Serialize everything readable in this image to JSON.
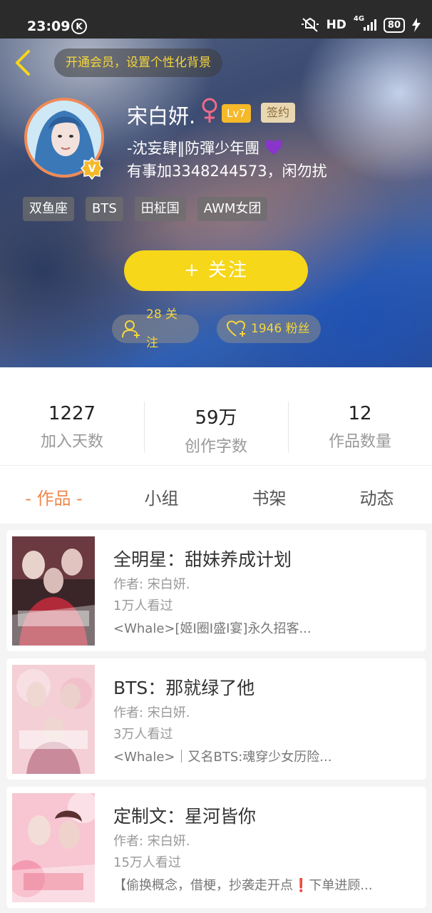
{
  "status_bar": {
    "time": "23:09",
    "carrier_icon": "K",
    "network": "HD",
    "signal_label": "4G",
    "battery": "80"
  },
  "header": {
    "vip_banner": "开通会员，设置个性化背景",
    "name": "宋白妍.",
    "level": "Lv7",
    "sign_badge": "签约",
    "bio_line1": "-沈妄肆‖防彈少年團",
    "bio_line2": "有事加3348244573，闲勿扰",
    "tags": [
      "双鱼座",
      "BTS",
      "田柾国",
      "AWM女团"
    ],
    "follow_button": "+ 关注",
    "following": "28 关注",
    "fans": "1946 粉丝"
  },
  "stats": [
    {
      "value": "1227",
      "label": "加入天数"
    },
    {
      "value": "59万",
      "label": "创作字数"
    },
    {
      "value": "12",
      "label": "作品数量"
    }
  ],
  "tabs": [
    {
      "label": "- 作品 -",
      "active": true
    },
    {
      "label": "小组",
      "active": false
    },
    {
      "label": "书架",
      "active": false
    },
    {
      "label": "动态",
      "active": false
    }
  ],
  "works": [
    {
      "title": "全明星：甜妹养成计划",
      "author": "作者: 宋白妍.",
      "views": "1万人看过",
      "desc": "<Whale>[姬I圈I盛I宴]永久招客..."
    },
    {
      "title": "BTS：那就绿了他",
      "author": "作者: 宋白妍.",
      "views": "3万人看过",
      "desc": "<Whale>｜又名BTS:魂穿少女历险..."
    },
    {
      "title": "定制文：星河皆你",
      "author": "作者: 宋白妍.",
      "views": "15万人看过",
      "desc": "【偷换概念，借梗，抄袭走开点❗下单进顾..."
    }
  ],
  "colors": {
    "accent_yellow": "#f6d719",
    "tab_active": "#f0884c",
    "avatar_border": "#f08a55"
  },
  "icons": {
    "back": "back-arrow-icon",
    "female": "female-symbol-icon",
    "verified": "v-badge-icon",
    "heart": "purple-heart-icon",
    "follow_pill": "add-person-icon",
    "fans_pill": "heart-outline-icon"
  }
}
